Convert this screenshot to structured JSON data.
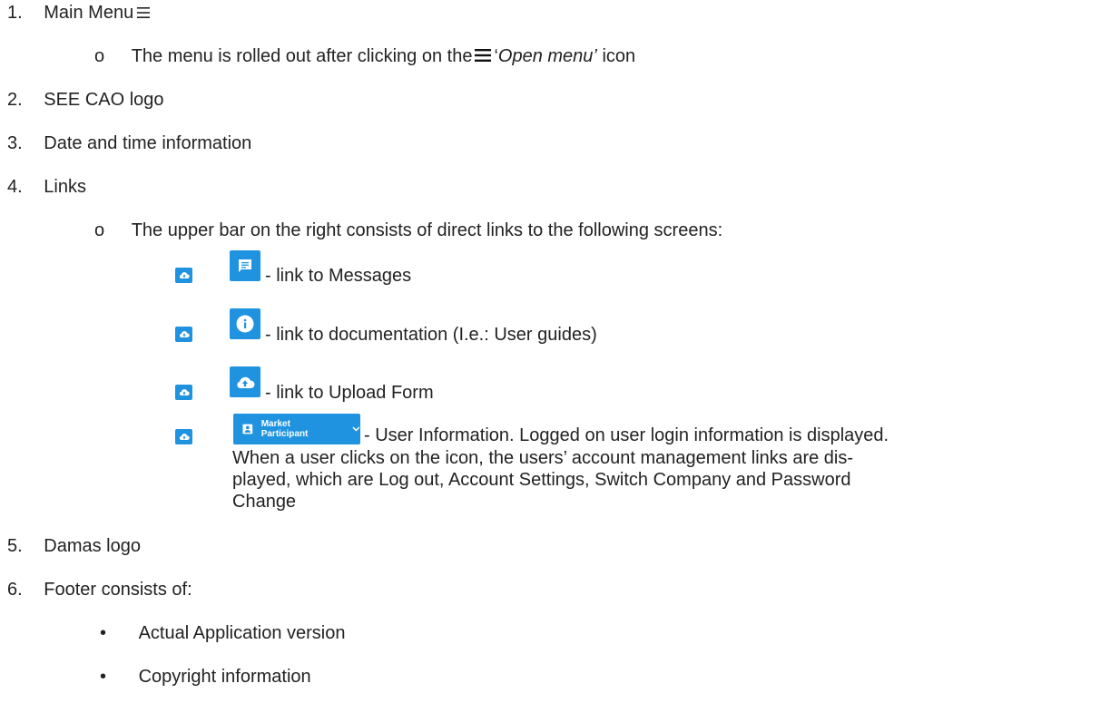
{
  "items": [
    {
      "num": "1.",
      "text": "Main Menu"
    },
    {
      "num": "2.",
      "text": "SEE CAO logo"
    },
    {
      "num": "3.",
      "text": "Date and time information"
    },
    {
      "num": "4.",
      "text": "Links"
    },
    {
      "num": "5.",
      "text": "Damas logo"
    },
    {
      "num": "6.",
      "text": "Footer consists of:"
    }
  ],
  "menu_sub": {
    "bullet": "o",
    "before": "The menu is rolled out after clicking on the",
    "quote_open": "‘",
    "italic": "Open menu’",
    "after": "icon"
  },
  "links_sub": {
    "bullet": "o",
    "text": "The upper bar on the right consists of direct links to the following screens:"
  },
  "link_items": [
    {
      "icon": "message-icon",
      "text": "- link to Messages"
    },
    {
      "icon": "info-icon",
      "text": "- link to documentation (I.e.: User guides)"
    },
    {
      "icon": "upload-cloud-icon",
      "text": "- link to Upload Form"
    }
  ],
  "user_info": {
    "button_label": "Market Participant",
    "button_icon": "user-badge-icon",
    "line1": "- User Information.  Logged on user login information is displayed.",
    "line2": "When a user clicks on the icon, the users’ account management links are dis-",
    "line3": "played, which are Log out, Account Settings, Switch Company and Password",
    "line4": "Change"
  },
  "footer_items": [
    {
      "bullet": "•",
      "text": "Actual Application version"
    },
    {
      "bullet": "•",
      "text": "Copyright information"
    }
  ],
  "colors": {
    "accent": "#1f93e0",
    "text": "#222222"
  }
}
